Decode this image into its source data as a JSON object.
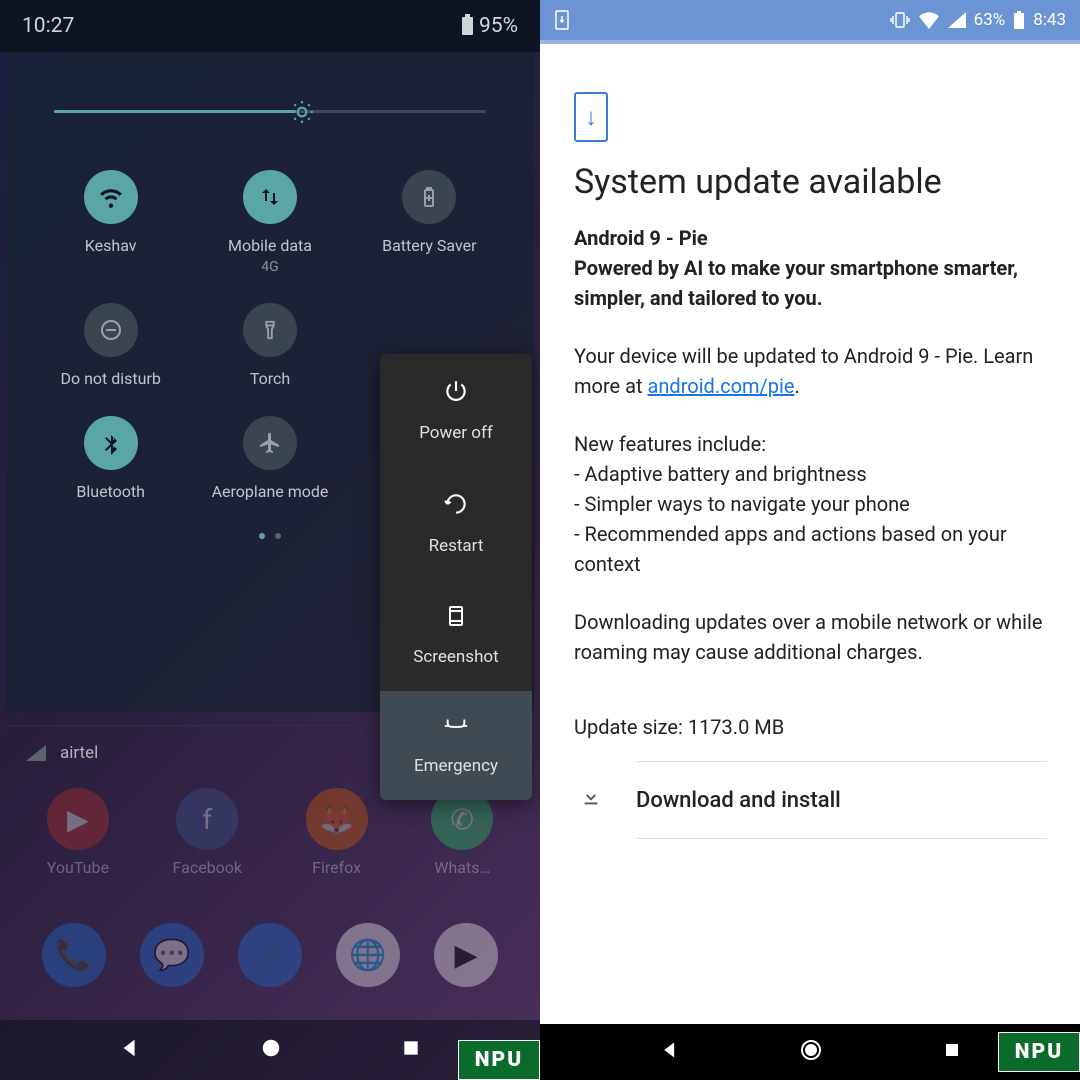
{
  "left": {
    "status": {
      "time": "10:27",
      "battery": "95%"
    },
    "tiles": [
      {
        "id": "wifi",
        "label": "Keshav",
        "on": true,
        "icon": "wifi"
      },
      {
        "id": "data",
        "label": "Mobile data",
        "sub": "4G",
        "on": true,
        "icon": "data"
      },
      {
        "id": "saver",
        "label": "Battery Saver",
        "on": false,
        "icon": "battery"
      },
      {
        "id": "dnd",
        "label": "Do not disturb",
        "on": false,
        "icon": "dnd"
      },
      {
        "id": "torch",
        "label": "Torch",
        "on": false,
        "icon": "torch"
      },
      {
        "id": "hidden",
        "label": "",
        "on": true,
        "icon": ""
      },
      {
        "id": "bt",
        "label": "Bluetooth",
        "on": true,
        "icon": "bt"
      },
      {
        "id": "air",
        "label": "Aeroplane mode",
        "on": false,
        "icon": "plane"
      }
    ],
    "carrier": "airtel",
    "power": [
      {
        "id": "off",
        "label": "Power off"
      },
      {
        "id": "restart",
        "label": "Restart"
      },
      {
        "id": "shot",
        "label": "Screenshot"
      },
      {
        "id": "emerg",
        "label": "Emergency"
      }
    ],
    "apps": [
      "YouTube",
      "Facebook",
      "Firefox",
      "Whats…"
    ],
    "npu": "NPU"
  },
  "right": {
    "status": {
      "battery": "63%",
      "time": "8:43"
    },
    "title": "System update available",
    "sub1": "Android 9 - Pie",
    "sub2": "Powered by AI to make your smartphone smarter, simpler, and tailored to you.",
    "p1a": "Your device will be updated to Android 9 - Pie. Learn more at ",
    "p1link": "android.com/pie",
    "feat_head": "New features include:",
    "feat1": "- Adaptive battery and brightness",
    "feat2": "- Simpler ways to navigate your phone",
    "feat3": "- Recommended apps and actions based on your context",
    "p2": "Downloading updates over a mobile network or while roaming may cause additional charges.",
    "size": "Update size: 1173.0 MB",
    "dl": "Download and install",
    "npu": "NPU"
  }
}
